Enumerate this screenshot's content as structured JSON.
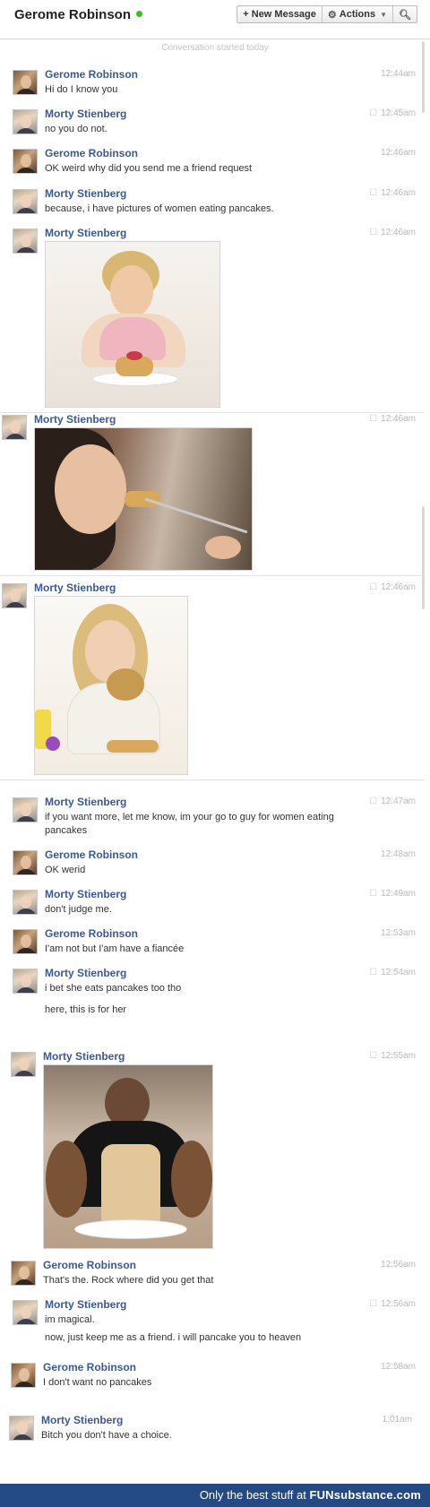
{
  "header": {
    "title": "Gerome Robinson",
    "new_message_label": "+ New Message",
    "actions_label": "Actions",
    "search_icon": "search-icon"
  },
  "conversation_started": "Conversation started today",
  "messages": [
    {
      "author": "Gerome Robinson",
      "time": "12:44am",
      "text": "Hi do I know you"
    },
    {
      "author": "Morty Stienberg",
      "time": "12:45am",
      "text": "no you do not."
    },
    {
      "author": "Gerome Robinson",
      "time": "12:46am",
      "text": "OK weird why did you send me a friend request"
    },
    {
      "author": "Morty Stienberg",
      "time": "12:46am",
      "text": "because, i have pictures of women eating pancakes."
    },
    {
      "author": "Morty Stienberg",
      "time": "12:46am"
    },
    {
      "author": "Morty Stienberg",
      "time": "12:46am"
    },
    {
      "author": "Morty Stienberg",
      "time": "12:46am"
    },
    {
      "author": "Morty Stienberg",
      "time": "12:47am",
      "text": "if you want more, let me know, im your go to guy for women eating pancakes"
    },
    {
      "author": "Gerome Robinson",
      "time": "12:48am",
      "text": "OK werid"
    },
    {
      "author": "Morty Stienberg",
      "time": "12:49am",
      "text": "don't judge me."
    },
    {
      "author": "Gerome Robinson",
      "time": "12:53am",
      "text": "I'am not but I'am have a fiancée"
    },
    {
      "author": "Morty Stienberg",
      "time": "12:54am",
      "text": "i bet she eats pancakes too tho",
      "text2": "here, this is for her"
    },
    {
      "author": "Morty Stienberg",
      "time": "12:55am"
    },
    {
      "author": "Gerome Robinson",
      "time": "12:56am",
      "text": "That's the. Rock where did you get that"
    },
    {
      "author": "Morty Stienberg",
      "time": "12:56am",
      "text": "im magical.",
      "text2": "now, just keep me as a friend. i will pancake you to heaven"
    },
    {
      "author": "Gerome Robinson",
      "time": "12:58am",
      "text": "I don't want no pancakes"
    },
    {
      "author": "Morty Stienberg",
      "time": "1:01am",
      "text": "Bitch you don't have a choice."
    }
  ],
  "footer": {
    "tagline": "Only the best stuff at",
    "brand": "FUNsubstance.com"
  },
  "colors": {
    "author_link": "#3b5998",
    "online": "#42b72a",
    "footer_bg": "#244a86"
  }
}
